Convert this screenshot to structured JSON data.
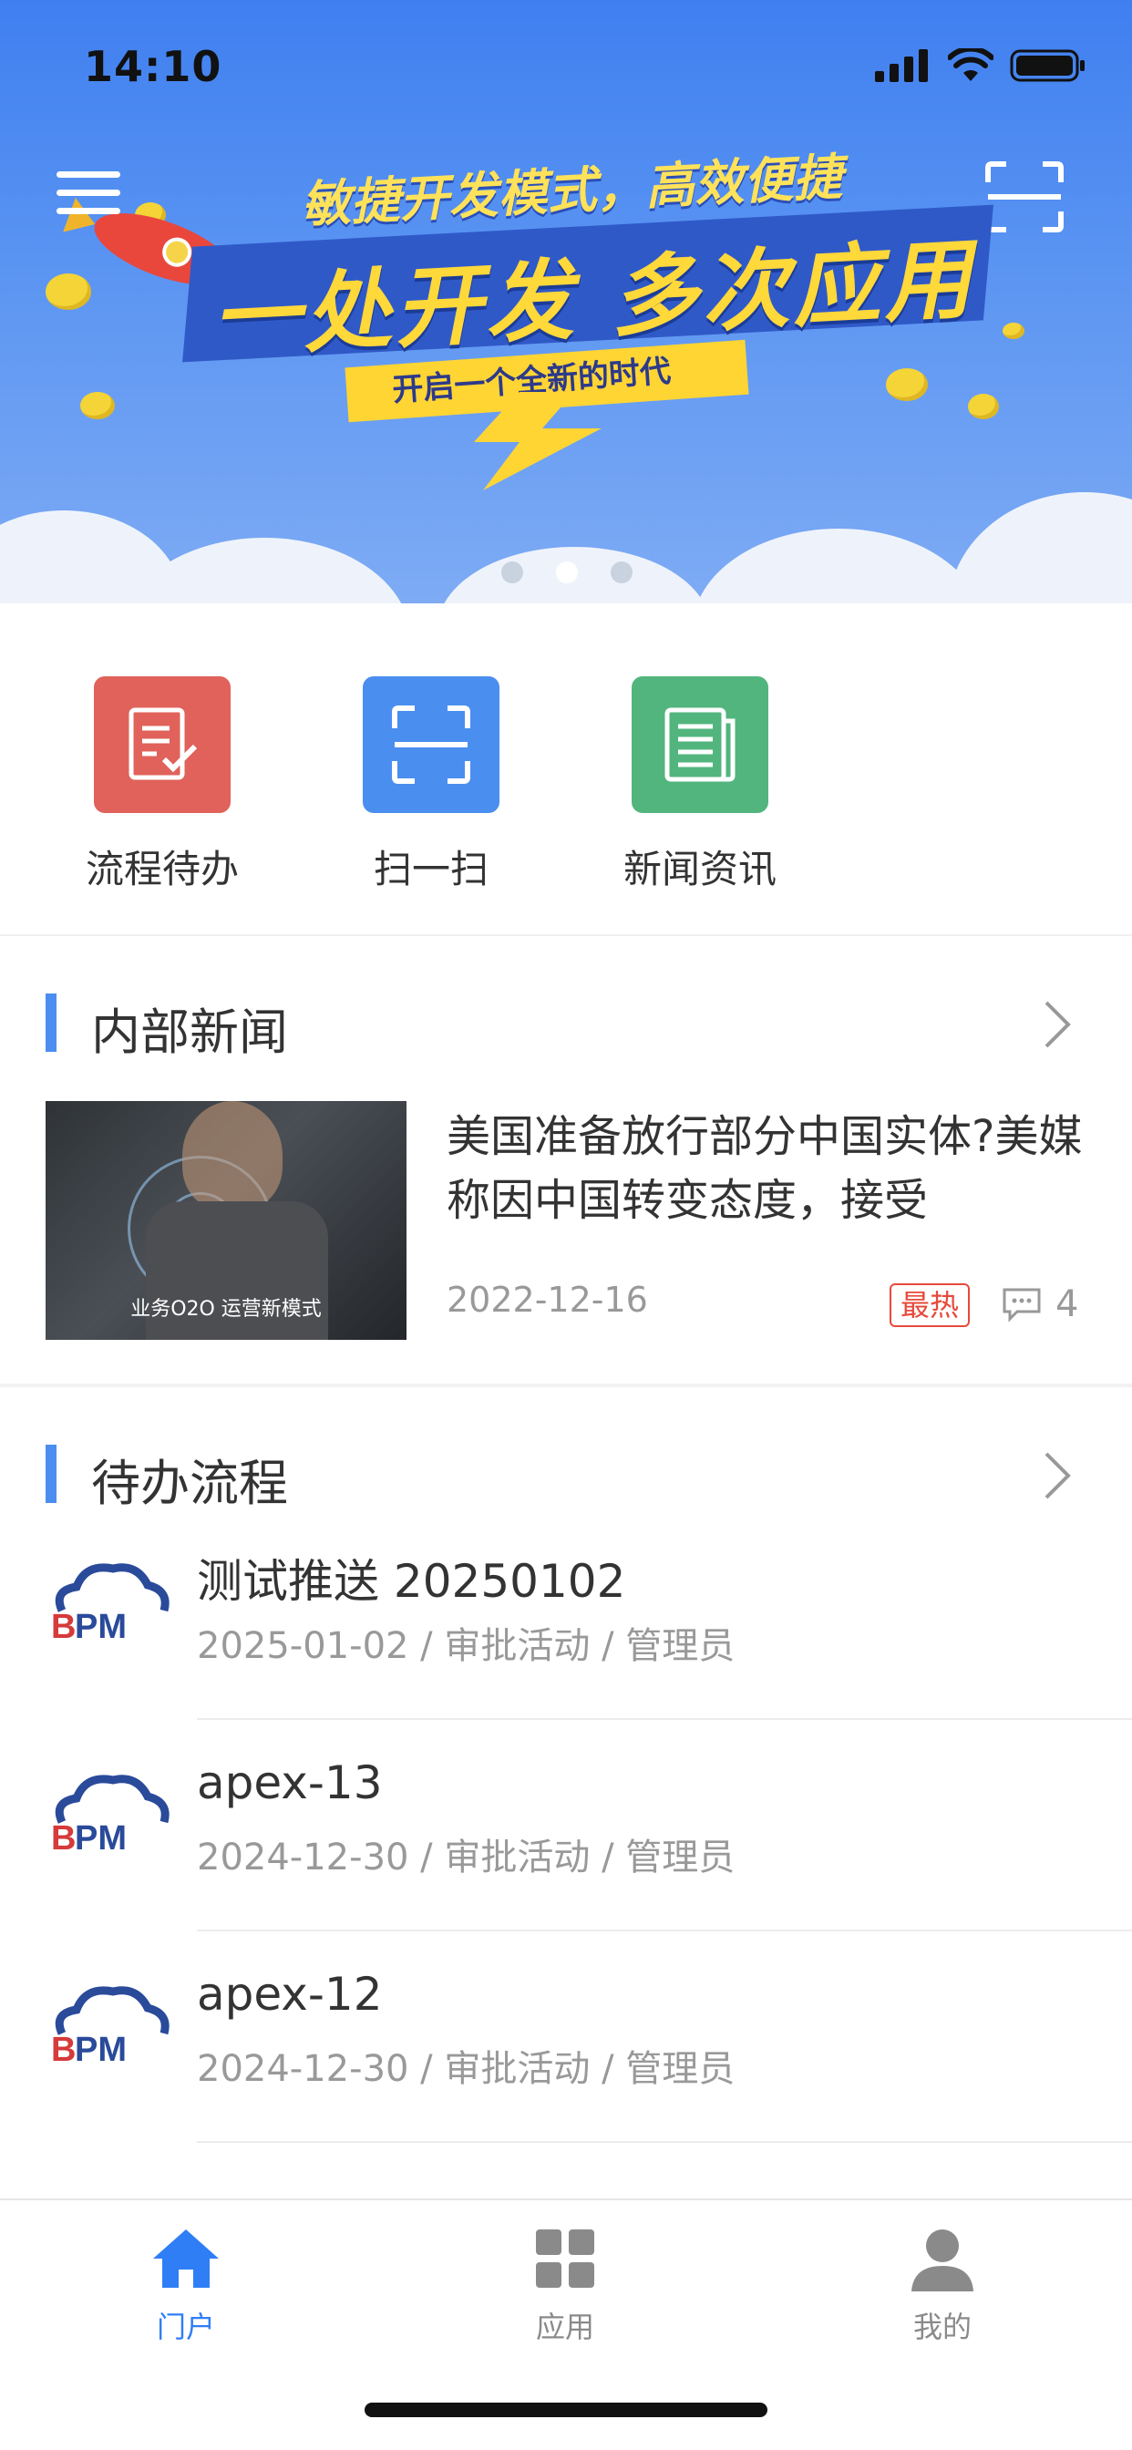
{
  "status_bar": {
    "time": "14:10"
  },
  "banner": {
    "headline_top": "敏捷开发模式，高效便捷",
    "headline_main": "一处开发 多次应用",
    "sub_text": "开启一个全新的时代",
    "page_indicator": {
      "total": 3,
      "active_index": 1
    }
  },
  "quick_actions": [
    {
      "label": "流程待办",
      "icon": "task-check-icon",
      "color": "#e0625a"
    },
    {
      "label": "扫一扫",
      "icon": "scan-icon",
      "color": "#4a8ef0"
    },
    {
      "label": "新闻资讯",
      "icon": "news-icon",
      "color": "#52b57e"
    }
  ],
  "internal_news": {
    "section_title": "内部新闻",
    "item": {
      "title": "美国准备放行部分中国实体?美媒称因中国转变态度，接受",
      "image_caption": "业务O2O  运营新模式",
      "date": "2022-12-16",
      "badge": "最热",
      "comment_count": "4"
    }
  },
  "todo_process": {
    "section_title": "待办流程",
    "items": [
      {
        "title": "测试推送 20250102",
        "meta": "2025-01-02 / 审批活动 / 管理员"
      },
      {
        "title": "apex-13",
        "meta": "2024-12-30 / 审批活动 / 管理员"
      },
      {
        "title": "apex-12",
        "meta": "2024-12-30 / 审批活动 / 管理员"
      }
    ]
  },
  "tab_bar": {
    "tabs": [
      {
        "label": "门户",
        "icon": "home-icon",
        "active": true
      },
      {
        "label": "应用",
        "icon": "grid-apps-icon",
        "active": false
      },
      {
        "label": "我的",
        "icon": "person-icon",
        "active": false
      }
    ]
  },
  "colors": {
    "accent": "#2f7ef6",
    "hot": "#e64a3b",
    "section_bar": "#4b8ef0"
  }
}
